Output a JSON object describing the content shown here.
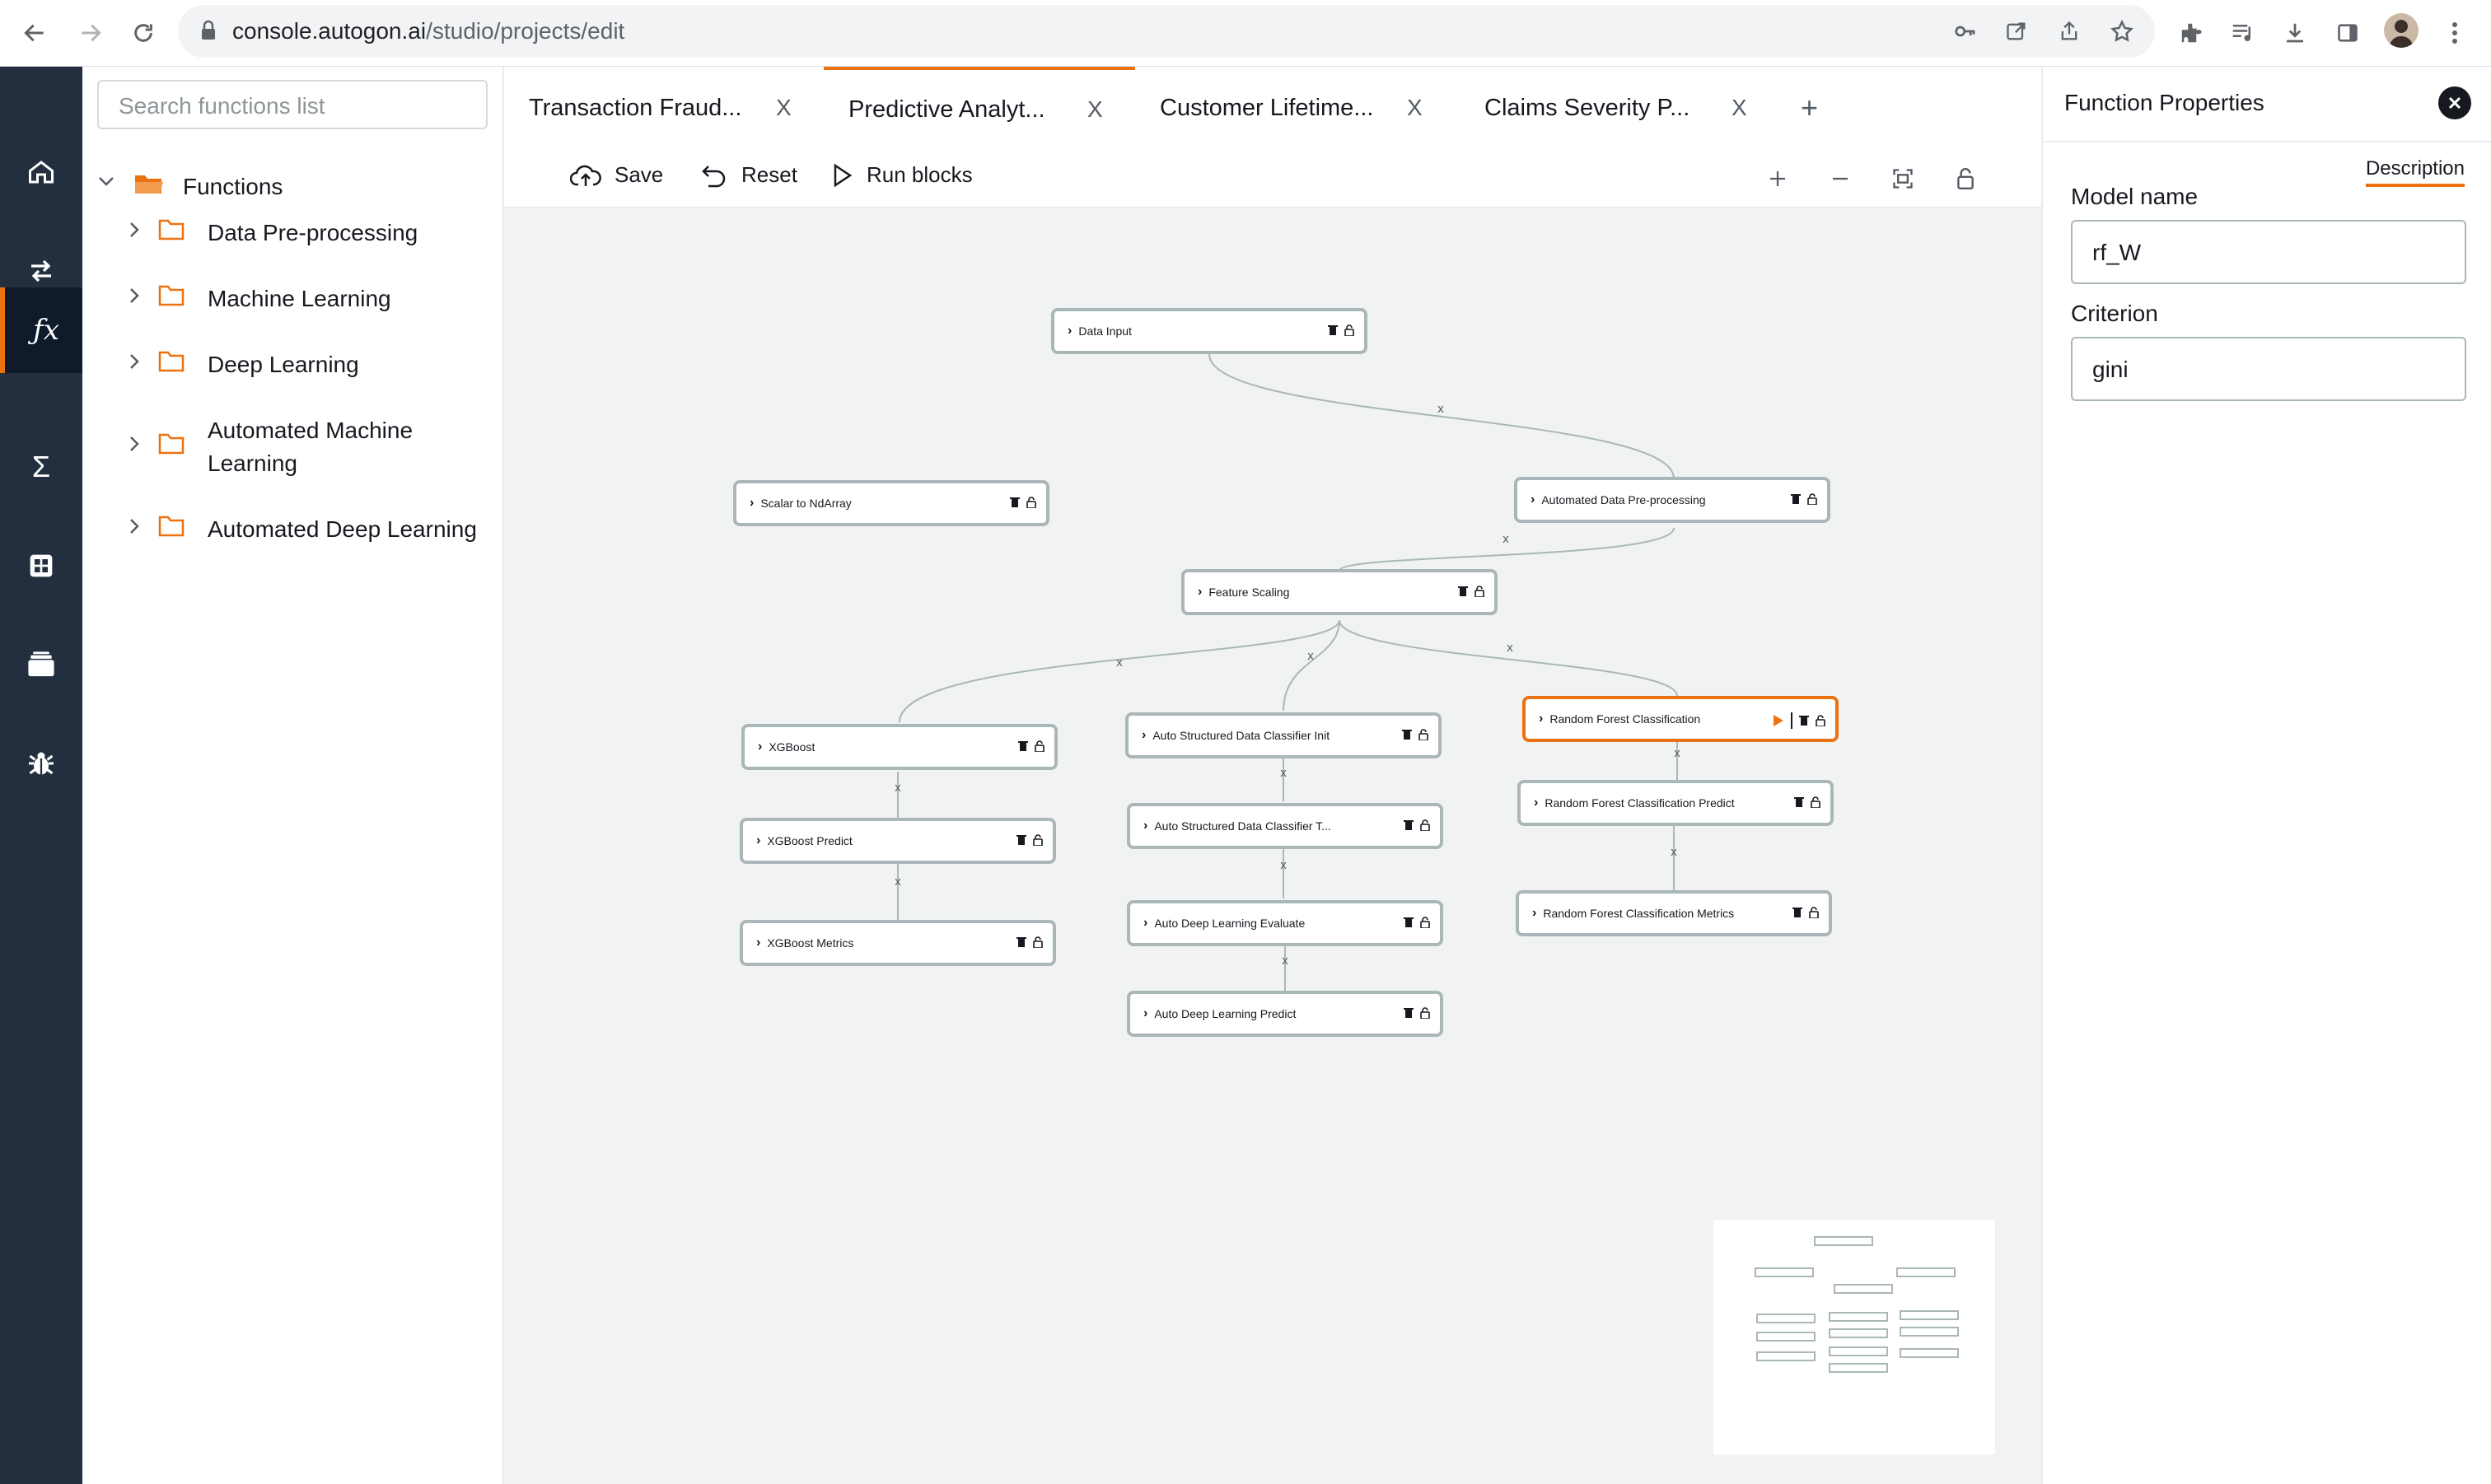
{
  "browser": {
    "url_host": "console.autogon.ai",
    "url_path": "/studio/projects/edit"
  },
  "rail": {
    "items": [
      "home-icon",
      "transfer-icon",
      "function-icon",
      "sigma-icon",
      "dashboard-icon",
      "storage-icon",
      "bug-icon"
    ],
    "active_index": 2
  },
  "functions_panel": {
    "search_placeholder": "Search functions list",
    "root_label": "Functions",
    "folders": [
      {
        "label": "Data Pre-processing"
      },
      {
        "label": "Machine Learning"
      },
      {
        "label": "Deep Learning"
      },
      {
        "label": "Automated Machine Learning",
        "line1": "Automated Machine",
        "line2": "Learning"
      },
      {
        "label": "Automated Deep Learning"
      }
    ]
  },
  "tabs": [
    {
      "label": "Transaction Fraud...",
      "close": "X"
    },
    {
      "label": "Predictive Analyt...",
      "close": "X",
      "active": true
    },
    {
      "label": "Customer Lifetime...",
      "close": "X"
    },
    {
      "label": "Claims Severity P...",
      "close": "X"
    }
  ],
  "new_tab_symbol": "+",
  "toolbar": {
    "save_label": "Save",
    "reset_label": "Reset",
    "run_label": "Run blocks"
  },
  "nodes": {
    "data_input": "Data Input",
    "scalar": "Scalar to NdArray",
    "auto_preproc": "Automated Data Pre-processing",
    "feature_scaling": "Feature Scaling",
    "xgboost": "XGBoost",
    "xgboost_predict": "XGBoost Predict",
    "xgboost_metrics": "XGBoost Metrics",
    "asdc_init": "Auto Structured Data Classifier Init",
    "asdc_train": "Auto Structured Data Classifier T...",
    "adl_eval": "Auto Deep Learning Evaluate",
    "adl_predict": "Auto Deep Learning Predict",
    "rf_class": "Random Forest Classification",
    "rf_predict": "Random Forest Classification Predict",
    "rf_metrics": "Random Forest Classification Metrics"
  },
  "edge_marker": "x",
  "properties": {
    "title": "Function Properties",
    "tab": "Description",
    "model_name_label": "Model name",
    "model_name_value": "rf_W",
    "criterion_label": "Criterion",
    "criterion_value": "gini"
  },
  "colors": {
    "accent": "#ec7211",
    "rail": "#232f3e",
    "node_border": "#aab7b8"
  }
}
